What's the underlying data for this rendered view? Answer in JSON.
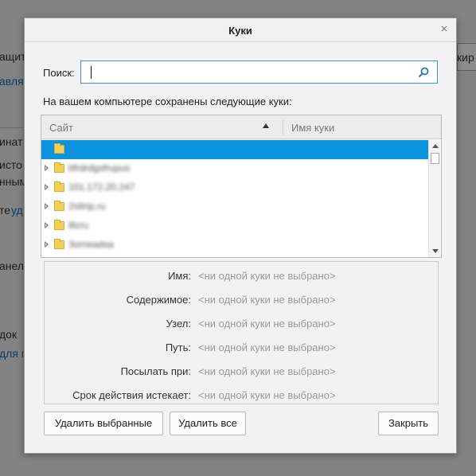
{
  "background": {
    "fragments": [
      "ащиту",
      "авля",
      "инат",
      "исто",
      "нным",
      "те",
      "уд",
      "анел",
      "док",
      "для п",
      "кир"
    ]
  },
  "dialog": {
    "title": "Куки",
    "close_glyph": "×",
    "search": {
      "label": "Поиск:",
      "value": "",
      "placeholder": ""
    },
    "description": "На вашем компьютере сохранены следующие куки:",
    "tree": {
      "col_site": "Сайт",
      "col_name": "Имя куки",
      "rows": [
        {
          "host": "",
          "selected": true,
          "expandable": false
        },
        {
          "host": "bfrdrdgsfrupus",
          "selected": false,
          "expandable": true
        },
        {
          "host": "101.172.20.247",
          "selected": false,
          "expandable": true
        },
        {
          "host": "2sttrip.ru",
          "selected": false,
          "expandable": true
        },
        {
          "host": "lltcru",
          "selected": false,
          "expandable": true
        },
        {
          "host": "3orneadsa",
          "selected": false,
          "expandable": true
        }
      ]
    },
    "details": [
      {
        "label": "Имя:",
        "value": "<ни одной куки не выбрано>"
      },
      {
        "label": "Содержимое:",
        "value": "<ни одной куки не выбрано>"
      },
      {
        "label": "Узел:",
        "value": "<ни одной куки не выбрано>"
      },
      {
        "label": "Путь:",
        "value": "<ни одной куки не выбрано>"
      },
      {
        "label": "Посылать при:",
        "value": "<ни одной куки не выбрано>"
      },
      {
        "label": "Срок действия истекает:",
        "value": "<ни одной куки не выбрано>"
      }
    ],
    "buttons": {
      "remove_selected": "Удалить выбранные",
      "remove_all": "Удалить все",
      "close": "Закрыть"
    }
  },
  "colors": {
    "selection": "#0b93de",
    "search_border": "#3b8ed8",
    "folder": "#f3cf5b"
  },
  "icons": {
    "search": "search-icon",
    "close": "close-icon",
    "folder": "folder-icon",
    "expand": "expand-arrow-icon"
  }
}
